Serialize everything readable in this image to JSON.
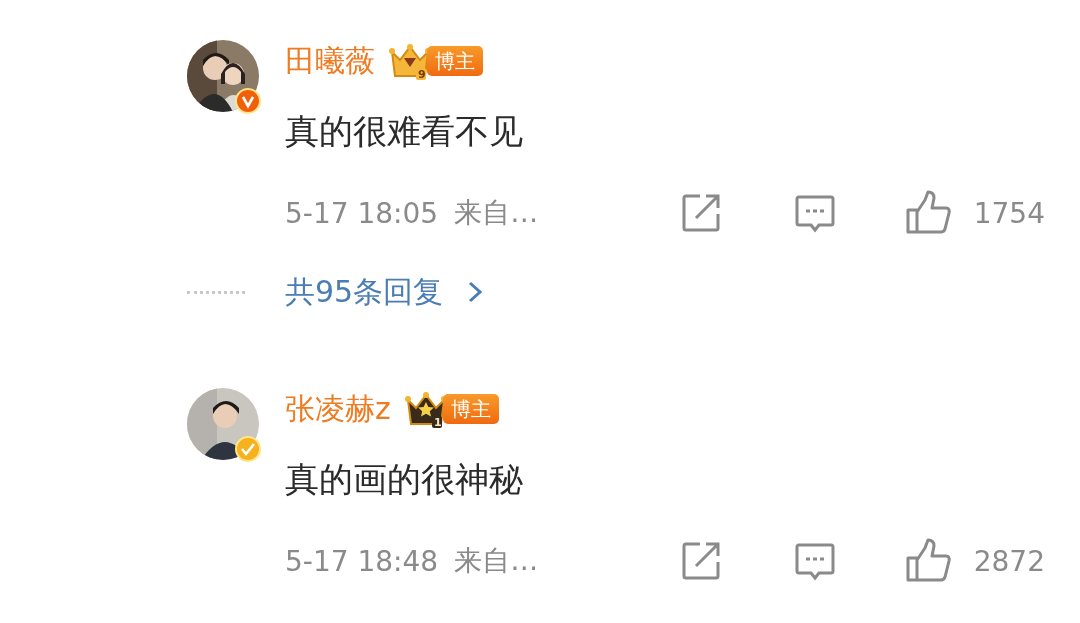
{
  "comments": [
    {
      "author": "田曦薇",
      "crown": {
        "kind": "gem",
        "level": "9"
      },
      "badge": "博主",
      "verify_badge": {
        "kind": "v"
      },
      "text": "真的很难看不见",
      "time": "5-17 18:05",
      "source": "来自…",
      "likes": "1754",
      "replies": "共95条回复"
    },
    {
      "author": "张凌赫z",
      "crown": {
        "kind": "star",
        "level": "1"
      },
      "badge": "博主",
      "verify_badge": {
        "kind": "check"
      },
      "text": "真的画的很神秘",
      "time": "5-17 18:48",
      "source": "来自…",
      "likes": "2872"
    }
  ]
}
